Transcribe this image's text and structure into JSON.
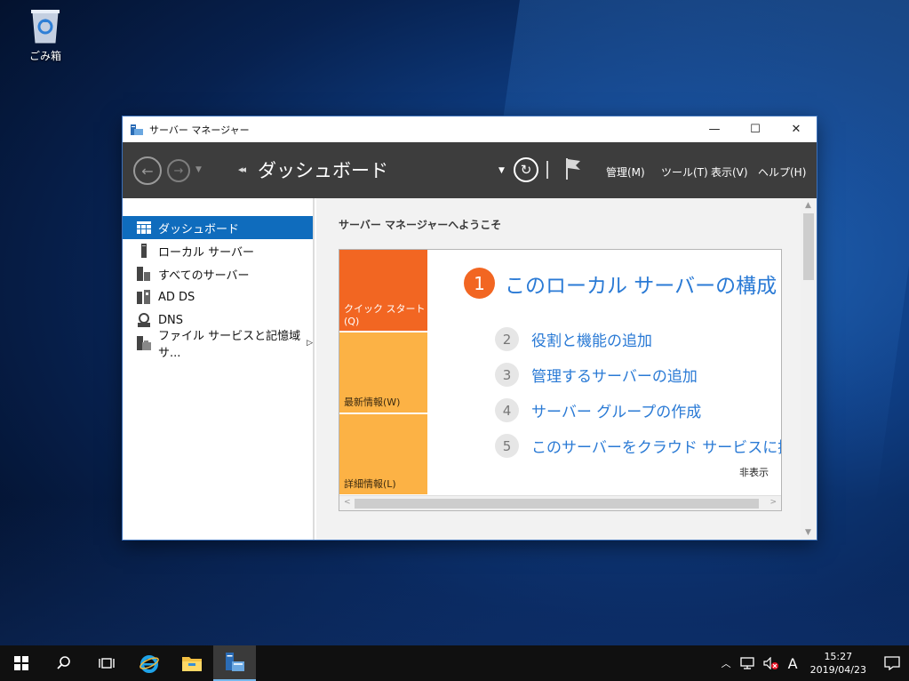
{
  "desktop": {
    "recycle_bin_label": "ごみ箱"
  },
  "window": {
    "title": "サーバー マネージャー",
    "controls": {
      "minimize": "—",
      "maximize": "☐",
      "close": "✕"
    }
  },
  "toolbar": {
    "breadcrumb_arrow": "◂◂",
    "page_title": "ダッシュボード",
    "menus": [
      "管理(M)",
      "ツール(T)",
      "表示(V)",
      "ヘルプ(H)"
    ]
  },
  "nav": {
    "items": [
      {
        "label": "ダッシュボード",
        "icon": "dashboard-icon",
        "selected": true
      },
      {
        "label": "ローカル サーバー",
        "icon": "server-icon",
        "selected": false
      },
      {
        "label": "すべてのサーバー",
        "icon": "servers-icon",
        "selected": false
      },
      {
        "label": "AD DS",
        "icon": "ad-ds-icon",
        "selected": false
      },
      {
        "label": "DNS",
        "icon": "dns-icon",
        "selected": false
      },
      {
        "label": "ファイル サービスと記憶域サ...",
        "icon": "file-services-icon",
        "selected": false,
        "has_submenu": true
      }
    ]
  },
  "content": {
    "welcome_title": "サーバー マネージャーへようこそ",
    "tiles": {
      "quick_start": "クイック スタート(Q)",
      "whats_new": "最新情報(W)",
      "learn_more": "詳細情報(L)"
    },
    "steps": [
      {
        "num": "1",
        "label": "このローカル サーバーの構成"
      },
      {
        "num": "2",
        "label": "役割と機能の追加"
      },
      {
        "num": "3",
        "label": "管理するサーバーの追加"
      },
      {
        "num": "4",
        "label": "サーバー グループの作成"
      },
      {
        "num": "5",
        "label": "このサーバーをクラウド サービスに接続する"
      }
    ],
    "hide_label": "非表示"
  },
  "taskbar": {
    "items": [
      "start-icon",
      "search-icon",
      "task-view-icon",
      "internet-explorer-icon",
      "file-explorer-icon",
      "server-manager-icon"
    ],
    "ime": "A",
    "time": "15:27",
    "date": "2019/04/23"
  },
  "colors": {
    "accent": "#0f6cbd",
    "quick_start_orange": "#f26622",
    "tile_yellow": "#fcb245",
    "link_blue": "#2a7ad5",
    "toolbar_gray": "#3d3d3d"
  }
}
